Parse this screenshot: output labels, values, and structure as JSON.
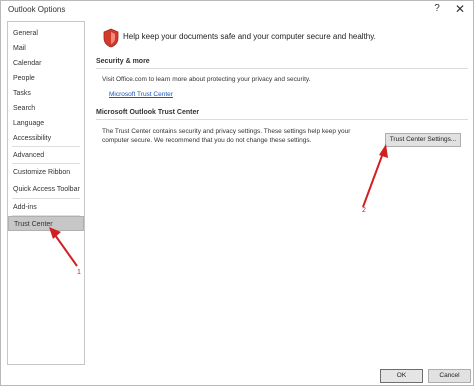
{
  "window": {
    "title": "Outlook Options",
    "help_glyph": "?",
    "close_glyph": "✕"
  },
  "sidebar": {
    "items": [
      {
        "label": "General"
      },
      {
        "label": "Mail"
      },
      {
        "label": "Calendar"
      },
      {
        "label": "People"
      },
      {
        "label": "Tasks"
      },
      {
        "label": "Search"
      },
      {
        "label": "Language"
      },
      {
        "label": "Accessibility"
      },
      {
        "label": "Advanced"
      },
      {
        "label": "Customize Ribbon"
      },
      {
        "label": "Quick Access Toolbar"
      },
      {
        "label": "Add-ins"
      },
      {
        "label": "Trust Center"
      }
    ],
    "selected": "Trust Center"
  },
  "main": {
    "headline": "Help keep your documents safe and your computer secure and healthy.",
    "security": {
      "title": "Security & more",
      "text": "Visit Office.com to learn more about protecting your privacy and security.",
      "link": "Microsoft Trust Center"
    },
    "trust_center": {
      "title": "Microsoft Outlook Trust Center",
      "text_line1": "The Trust Center contains security and privacy settings. These settings help keep your",
      "text_line2": "computer secure. We recommend that you do not change these settings.",
      "button": "Trust Center Settings..."
    }
  },
  "footer": {
    "ok": "OK",
    "cancel": "Cancel"
  },
  "annotations": {
    "marker_1": "1",
    "marker_2": "2",
    "color": "#d0201f"
  },
  "colors": {
    "link": "#1a56b8",
    "selected_bg": "#c7c7c7",
    "shield": "#d13b2b"
  }
}
